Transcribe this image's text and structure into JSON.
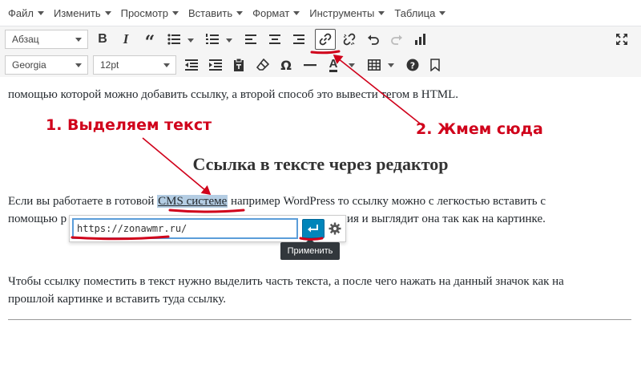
{
  "menubar": {
    "items": [
      {
        "label": "Файл"
      },
      {
        "label": "Изменить"
      },
      {
        "label": "Просмотр"
      },
      {
        "label": "Вставить"
      },
      {
        "label": "Формат"
      },
      {
        "label": "Инструменты"
      },
      {
        "label": "Таблица"
      }
    ]
  },
  "toolbar": {
    "paragraph_select": "Абзац",
    "font_family_select": "Georgia",
    "font_size_select": "12pt",
    "icons": [
      "bold-icon",
      "italic-icon",
      "blockquote-icon",
      "bullet-list-icon",
      "numbered-list-icon",
      "align-left-icon",
      "align-center-icon",
      "align-right-icon",
      "insert-link-icon",
      "unlink-icon",
      "undo-icon",
      "redo-icon",
      "chart-icon",
      "fullscreen-icon",
      "outdent-icon",
      "indent-icon",
      "paste-as-text-icon",
      "clear-formatting-icon",
      "special-character-icon",
      "horizontal-line-icon",
      "text-color-icon",
      "table-icon",
      "help-icon",
      "bookmark-icon"
    ]
  },
  "content": {
    "top_line": "помощью которой можно добавить ссылку, а второй способ это вывести тегом в HTML.",
    "heading": "Ссылка в тексте через редактор",
    "para1_before": "Если вы работаете в готовой ",
    "para1_link": "CMS системе",
    "para1_after": " например WordPress то ссылку можно с легкостью вставить с",
    "para1_line2_start": "помощью р",
    "para1_line2_end": "ия и выглядит она так как на картинке.",
    "para2_line1": "Чтобы ссылку поместить в текст нужно выделить часть текста, а после чего нажать на данный значок как на",
    "para2_line2": "прошлой картинке и вставить туда ссылку."
  },
  "link_popup": {
    "url_value": "https://zonawmr.ru/",
    "tooltip": "Применить"
  },
  "annotations": {
    "step1": "1. Выделяем текст",
    "step2": "2. Жмем сюда",
    "color": "#d0021b"
  }
}
